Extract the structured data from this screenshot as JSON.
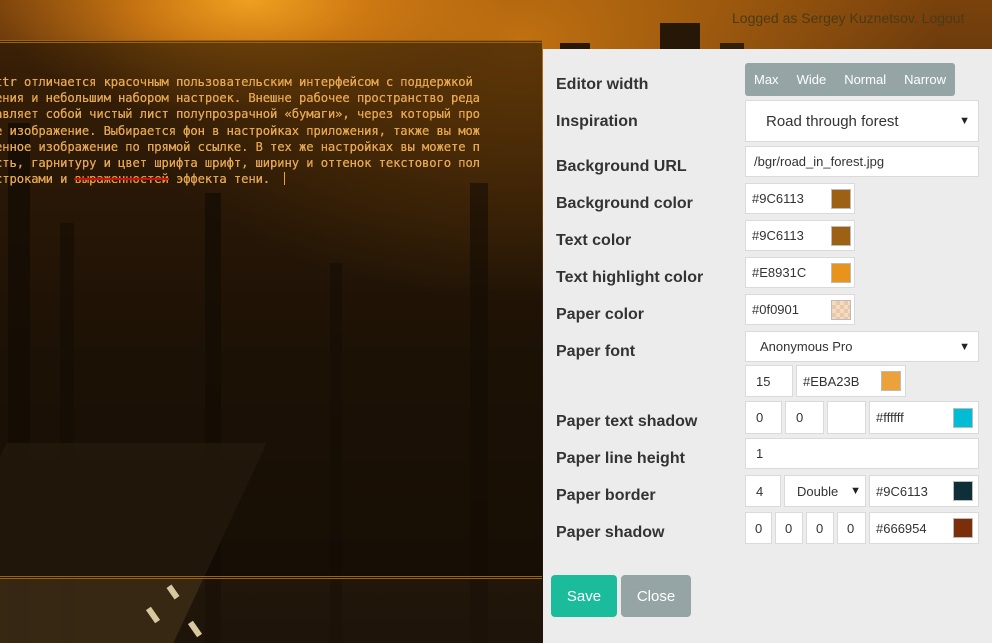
{
  "header": {
    "login_prefix": "Logged as Sergey Kuznetsov.",
    "logout_label": "Logout"
  },
  "paper": {
    "lines": [
      "ttr отличается красочным пользовательским интерфейсом с поддержкой",
      "ения и небольшим набором настроек. Внешне рабочее пространство реда",
      "авляет собой чистый лист полупрозрачной «бумаги», через который про",
      "е изображение. Выбирается фон в настройках приложения, также вы мож",
      "енное изображение по прямой ссылке. В тех же настройках вы можете п",
      "сть, гарнитуру и цвет шрифта шрифт, ширину и оттенок текстового пол"
    ],
    "last_line_start": "строками и ",
    "last_line_struck": "выраженностей",
    "last_line_end": " эффекта тени."
  },
  "settings": {
    "editor_width": {
      "label": "Editor width",
      "options": [
        "Max",
        "Wide",
        "Normal",
        "Narrow"
      ]
    },
    "inspiration": {
      "label": "Inspiration",
      "value": "Road through forest"
    },
    "background_url": {
      "label": "Background URL",
      "value": "/bgr/road_in_forest.jpg"
    },
    "background_color": {
      "label": "Background color",
      "value": "#9C6113",
      "swatch": "#9C6113"
    },
    "text_color": {
      "label": "Text color",
      "value": "#9C6113",
      "swatch": "#9C6113"
    },
    "text_highlight_color": {
      "label": "Text highlight color",
      "value": "#E8931C",
      "swatch": "#E8931C"
    },
    "paper_color": {
      "label": "Paper color",
      "value": "#0f0901",
      "swatch": "#0f0901"
    },
    "paper_font": {
      "label": "Paper font",
      "value": "Anonymous Pro",
      "size": "15",
      "color": "#EBA23B",
      "swatch": "#EBA23B"
    },
    "paper_text_shadow": {
      "label": "Paper text shadow",
      "x": "0",
      "y": "0",
      "blur": "",
      "color": "#ffffff",
      "swatch": "#00BCD4"
    },
    "paper_line_height": {
      "label": "Paper line height",
      "value": "1"
    },
    "paper_border": {
      "label": "Paper border",
      "width": "4",
      "style": "Double",
      "color": "#9C6113",
      "swatch": "#0E2F38"
    },
    "paper_shadow": {
      "label": "Paper shadow",
      "a": "0",
      "b": "0",
      "c": "0",
      "d": "0",
      "color": "#666954",
      "swatch": "#7A2E0A"
    }
  },
  "actions": {
    "save": "Save",
    "close": "Close"
  },
  "colors": {
    "save_button": "#1abc9c",
    "close_button": "#95a5a6",
    "panel_bg": "#ececec"
  }
}
